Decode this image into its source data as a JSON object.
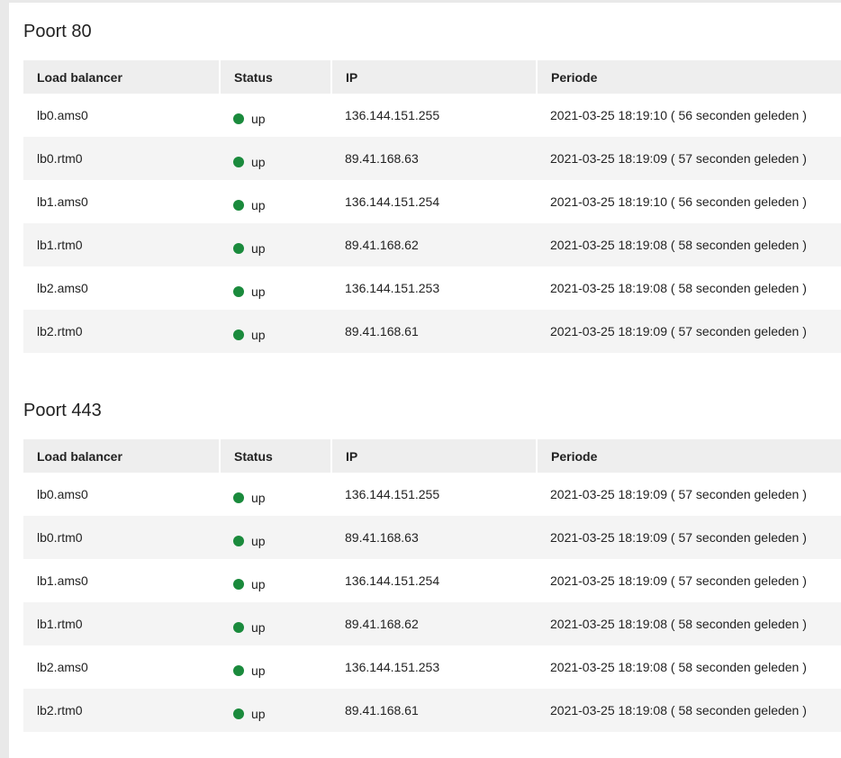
{
  "colors": {
    "status_up": "#1a8a3c",
    "header_bg": "#eeeeee",
    "row_alt_bg": "#f4f4f4"
  },
  "columns": [
    "Load balancer",
    "Status",
    "IP",
    "Periode"
  ],
  "sections": [
    {
      "title": "Poort 80",
      "rows": [
        {
          "lb": "lb0.ams0",
          "status": "up",
          "ip": "136.144.151.255",
          "period": "2021-03-25 18:19:10 ( 56 seconden geleden )"
        },
        {
          "lb": "lb0.rtm0",
          "status": "up",
          "ip": "89.41.168.63",
          "period": "2021-03-25 18:19:09 ( 57 seconden geleden )"
        },
        {
          "lb": "lb1.ams0",
          "status": "up",
          "ip": "136.144.151.254",
          "period": "2021-03-25 18:19:10 ( 56 seconden geleden )"
        },
        {
          "lb": "lb1.rtm0",
          "status": "up",
          "ip": "89.41.168.62",
          "period": "2021-03-25 18:19:08 ( 58 seconden geleden )"
        },
        {
          "lb": "lb2.ams0",
          "status": "up",
          "ip": "136.144.151.253",
          "period": "2021-03-25 18:19:08 ( 58 seconden geleden )"
        },
        {
          "lb": "lb2.rtm0",
          "status": "up",
          "ip": "89.41.168.61",
          "period": "2021-03-25 18:19:09 ( 57 seconden geleden )"
        }
      ]
    },
    {
      "title": "Poort 443",
      "rows": [
        {
          "lb": "lb0.ams0",
          "status": "up",
          "ip": "136.144.151.255",
          "period": "2021-03-25 18:19:09 ( 57 seconden geleden )"
        },
        {
          "lb": "lb0.rtm0",
          "status": "up",
          "ip": "89.41.168.63",
          "period": "2021-03-25 18:19:09 ( 57 seconden geleden )"
        },
        {
          "lb": "lb1.ams0",
          "status": "up",
          "ip": "136.144.151.254",
          "period": "2021-03-25 18:19:09 ( 57 seconden geleden )"
        },
        {
          "lb": "lb1.rtm0",
          "status": "up",
          "ip": "89.41.168.62",
          "period": "2021-03-25 18:19:08 ( 58 seconden geleden )"
        },
        {
          "lb": "lb2.ams0",
          "status": "up",
          "ip": "136.144.151.253",
          "period": "2021-03-25 18:19:08 ( 58 seconden geleden )"
        },
        {
          "lb": "lb2.rtm0",
          "status": "up",
          "ip": "89.41.168.61",
          "period": "2021-03-25 18:19:08 ( 58 seconden geleden )"
        }
      ]
    }
  ]
}
